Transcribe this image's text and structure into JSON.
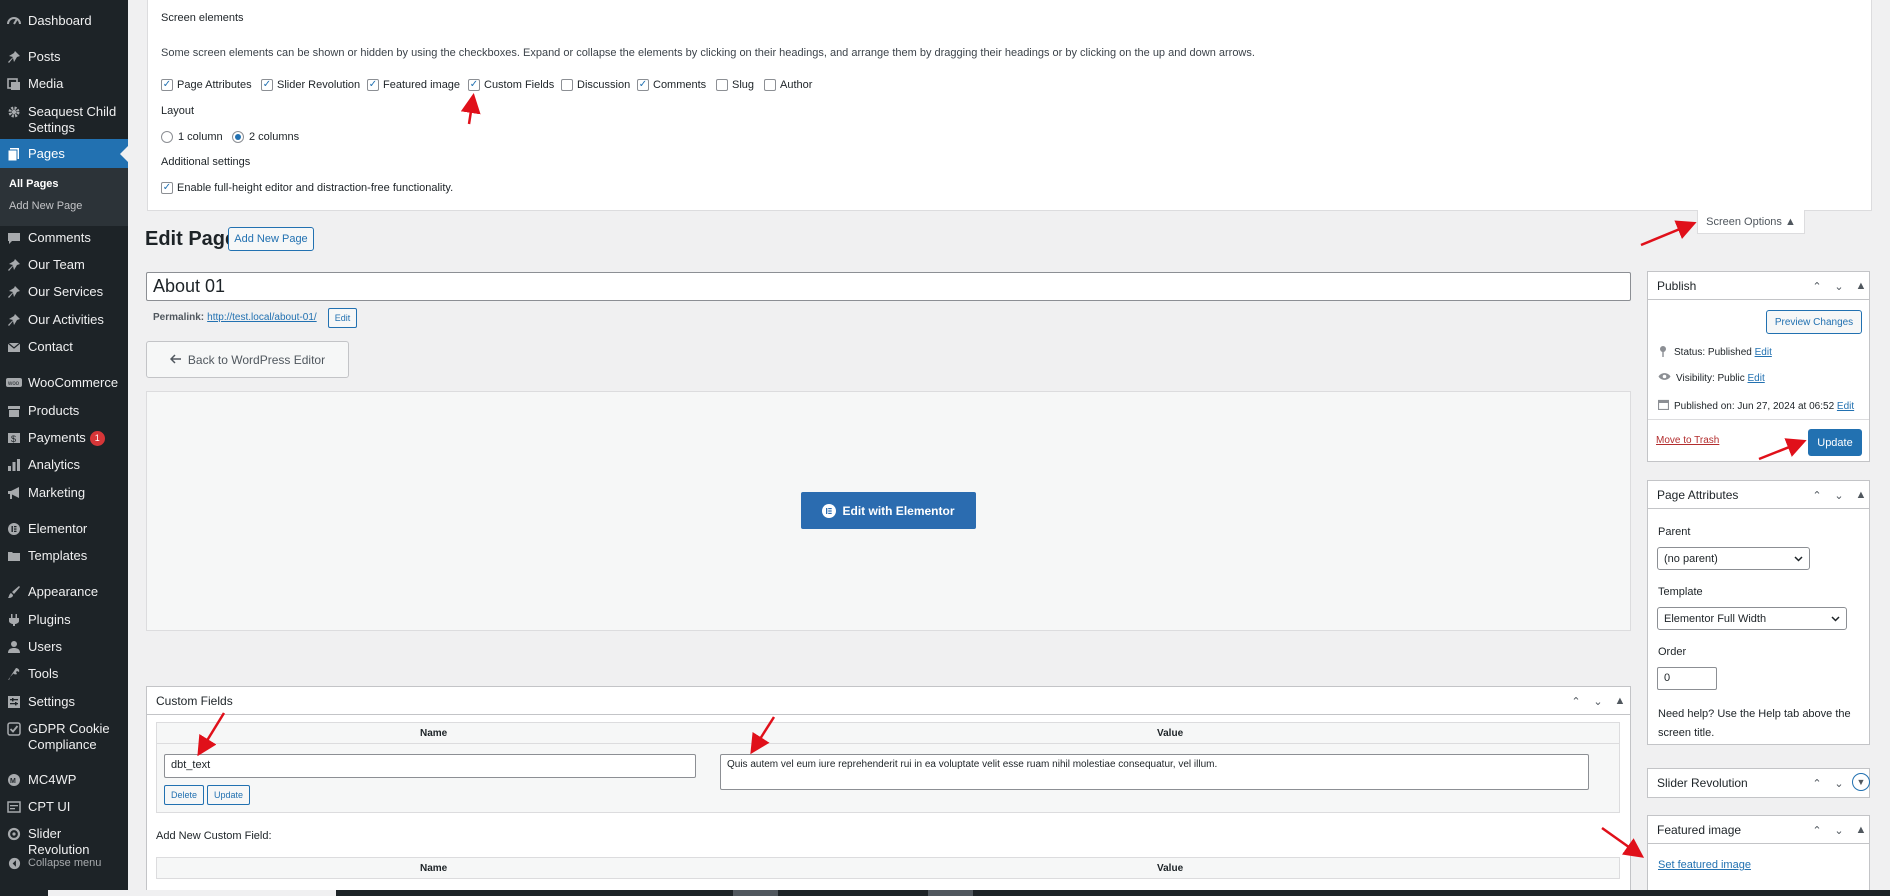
{
  "sidebar": {
    "items": [
      {
        "label": "Dashboard",
        "icon": "dashboard-icon"
      },
      {
        "label": "Posts",
        "icon": "pin-icon"
      },
      {
        "label": "Media",
        "icon": "media-icon"
      },
      {
        "label": "Seaquest Child Settings",
        "icon": "gear-icon"
      },
      {
        "label": "Pages",
        "icon": "pages-icon"
      },
      {
        "label": "Comments",
        "icon": "comment-icon"
      },
      {
        "label": "Our Team",
        "icon": "pin-icon"
      },
      {
        "label": "Our Services",
        "icon": "pin-icon"
      },
      {
        "label": "Our Activities",
        "icon": "pin-icon"
      },
      {
        "label": "Contact",
        "icon": "mail-icon"
      },
      {
        "label": "WooCommerce",
        "icon": "woo-icon"
      },
      {
        "label": "Products",
        "icon": "archive-icon"
      },
      {
        "label": "Payments",
        "icon": "dollar-icon",
        "badge": "1"
      },
      {
        "label": "Analytics",
        "icon": "chart-bar-icon"
      },
      {
        "label": "Marketing",
        "icon": "megaphone-icon"
      },
      {
        "label": "Elementor",
        "icon": "elementor-icon"
      },
      {
        "label": "Templates",
        "icon": "folder-icon"
      },
      {
        "label": "Appearance",
        "icon": "brush-icon"
      },
      {
        "label": "Plugins",
        "icon": "plug-icon"
      },
      {
        "label": "Users",
        "icon": "user-icon"
      },
      {
        "label": "Tools",
        "icon": "wrench-icon"
      },
      {
        "label": "Settings",
        "icon": "sliders-icon"
      },
      {
        "label": "GDPR Cookie Compliance",
        "icon": "check-square-icon"
      },
      {
        "label": "MC4WP",
        "icon": "mc4wp-icon"
      },
      {
        "label": "CPT UI",
        "icon": "cpt-icon"
      },
      {
        "label": "Slider Revolution",
        "icon": "revolution-icon"
      },
      {
        "label": "Collapse menu",
        "icon": "collapse-icon"
      }
    ],
    "submenu": {
      "all_pages": "All Pages",
      "add_new_page": "Add New Page"
    }
  },
  "screen_options": {
    "heading": "Screen elements",
    "description": "Some screen elements can be shown or hidden by using the checkboxes. Expand or collapse the elements by clicking on their headings, and arrange them by dragging their headings or by clicking on the up and down arrows.",
    "checkboxes": [
      {
        "label": "Page Attributes",
        "checked": true
      },
      {
        "label": "Slider Revolution",
        "checked": true
      },
      {
        "label": "Featured image",
        "checked": true
      },
      {
        "label": "Custom Fields",
        "checked": true
      },
      {
        "label": "Discussion",
        "checked": false
      },
      {
        "label": "Comments",
        "checked": true
      },
      {
        "label": "Slug",
        "checked": false
      },
      {
        "label": "Author",
        "checked": false
      }
    ],
    "layout_heading": "Layout",
    "layout_options": [
      "1 column",
      "2 columns"
    ],
    "layout_selected": "2 columns",
    "additional_heading": "Additional settings",
    "additional_option": "Enable full-height editor and distraction-free functionality.",
    "tab_label": "Screen Options ▲"
  },
  "editor": {
    "page_title": "Edit Page",
    "add_new_label": "Add New Page",
    "title_value": "About 01",
    "permalink_label": "Permalink:",
    "permalink_url": "http://test.local/about-01/",
    "permalink_edit": "Edit",
    "back_label": "Back to WordPress Editor",
    "elementor_label": "Edit with Elementor"
  },
  "custom_fields": {
    "title": "Custom Fields",
    "name_header": "Name",
    "value_header": "Value",
    "name_value": "dbt_text",
    "value_value": "Quis autem vel eum iure reprehenderit rui in ea voluptate velit esse ruam nihil molestiae consequatur, vel illum.",
    "delete_label": "Delete",
    "update_label": "Update",
    "add_new_label": "Add New Custom Field:"
  },
  "publish": {
    "title": "Publish",
    "preview_label": "Preview Changes",
    "status": "Status: Published",
    "visibility": "Visibility: Public",
    "published_on": "Published on: Jun 27, 2024 at 06:52",
    "edit_label": "Edit",
    "trash_label": "Move to Trash",
    "update_label": "Update"
  },
  "page_attributes": {
    "title": "Page Attributes",
    "parent_label": "Parent",
    "parent_value": "(no parent)",
    "template_label": "Template",
    "template_value": "Elementor Full Width",
    "order_label": "Order",
    "order_value": "0",
    "help_text": "Need help? Use the Help tab above the screen title."
  },
  "slider_revolution": {
    "title": "Slider Revolution"
  },
  "featured_image": {
    "title": "Featured image",
    "link": "Set featured image"
  },
  "colors": {
    "admin_bar": "#1d2327",
    "accent": "#2271b1",
    "annotation": "#e0101a"
  }
}
